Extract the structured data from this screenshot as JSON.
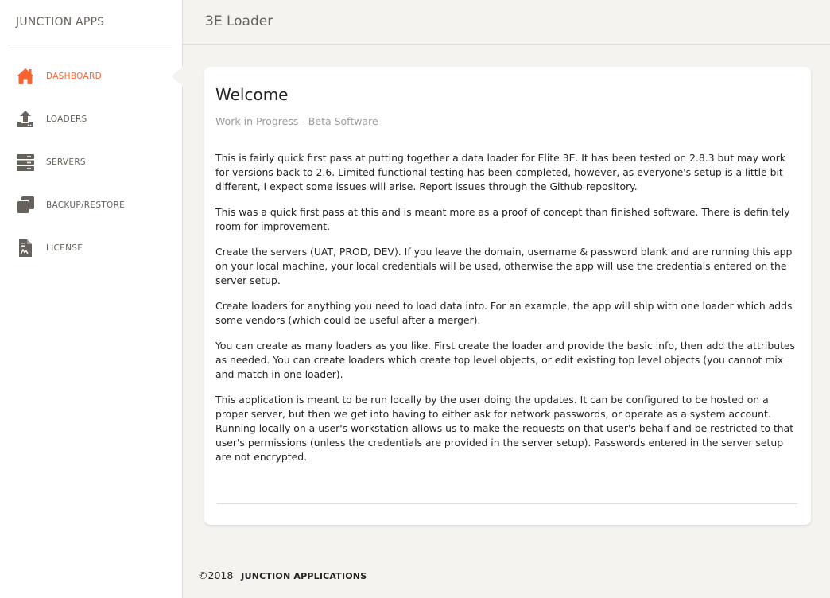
{
  "brand": {
    "name": "JUNCTION APPS"
  },
  "sidebar": {
    "items": [
      {
        "label": "DASHBOARD",
        "icon": "home-icon",
        "active": true
      },
      {
        "label": "LOADERS",
        "icon": "upload-icon",
        "active": false
      },
      {
        "label": "SERVERS",
        "icon": "server-icon",
        "active": false
      },
      {
        "label": "BACKUP/RESTORE",
        "icon": "copy-icon",
        "active": false
      },
      {
        "label": "LICENSE",
        "icon": "file-contract-icon",
        "active": false
      }
    ]
  },
  "header": {
    "title": "3E Loader"
  },
  "card": {
    "title": "Welcome",
    "subtitle": "Work in Progress - Beta Software",
    "paragraphs": [
      "This is fairly quick first pass at putting together a data loader for Elite 3E. It has been tested on 2.8.3 but may work for versions back to 2.6. Limited functional testing has been completed, however, as everyone's setup is a little bit different, I expect some issues will arise. Report issues through the Github repository.",
      "This was a quick first pass at this and is meant more as a proof of concept than finished software. There is definitely room for improvement.",
      "Create the servers (UAT, PROD, DEV). If you leave the domain, username & password blank and are running this app on your local machine, your local credentials will be used, otherwise the app will use the credentials entered on the server setup.",
      "Create loaders for anything you need to load data into. For an example, the app will ship with one loader which adds some vendors (which could be useful after a merger).",
      "You can create as many loaders as you like. First create the loader and provide the basic info, then add the attributes as needed. You can create loaders which create top level objects, or edit existing top level objects (you cannot mix and match in one loader).",
      "This application is meant to be run locally by the user doing the updates. It can be configured to be hosted on a proper server, but then we get into having to either ask for network passwords, or operate as a system account. Running locally on a user's workstation allows us to make the requests on that user's behalf and be restricted to that user's permissions (unless the credentials are provided in the server setup). Passwords entered in the server setup are not encrypted."
    ]
  },
  "footer": {
    "copyright": "©2018",
    "company": "JUNCTION APPLICATIONS"
  },
  "colors": {
    "accent": "#f96332",
    "icon": "#66615b",
    "background": "#f4f3ef"
  }
}
